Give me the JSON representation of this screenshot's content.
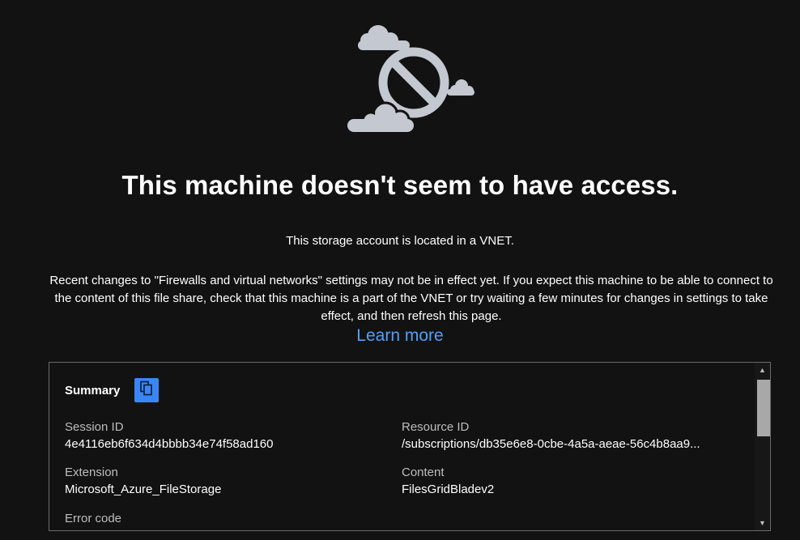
{
  "illustration": {
    "icon": "blocked-cloud-icon",
    "color": "#c4c8d0"
  },
  "title": "This machine doesn't seem to have access.",
  "subtitle": "This storage account is located in a VNET.",
  "description": "Recent changes to \"Firewalls and virtual networks\" settings may not be in effect yet. If you expect this machine to be able to connect to the content of this file share, check that this machine is a part of the VNET or try waiting a few minutes for changes in settings to take effect, and then refresh this page.",
  "learn_more": "Learn more",
  "colors": {
    "background": "#121212",
    "link": "#4ea1ff",
    "copy_button": "#3a86f5",
    "border": "#6b6b6b"
  },
  "summary": {
    "label": "Summary",
    "copy_icon": "copy-icon",
    "session_id": {
      "label": "Session ID",
      "value": "4e4116eb6f634d4bbbb34e74f58ad160"
    },
    "resource_id": {
      "label": "Resource ID",
      "value": "/subscriptions/db35e6e8-0cbe-4a5a-aeae-56c4b8aa9..."
    },
    "extension": {
      "label": "Extension",
      "value": "Microsoft_Azure_FileStorage"
    },
    "content": {
      "label": "Content",
      "value": "FilesGridBladev2"
    },
    "error_code": {
      "label": "Error code"
    }
  }
}
